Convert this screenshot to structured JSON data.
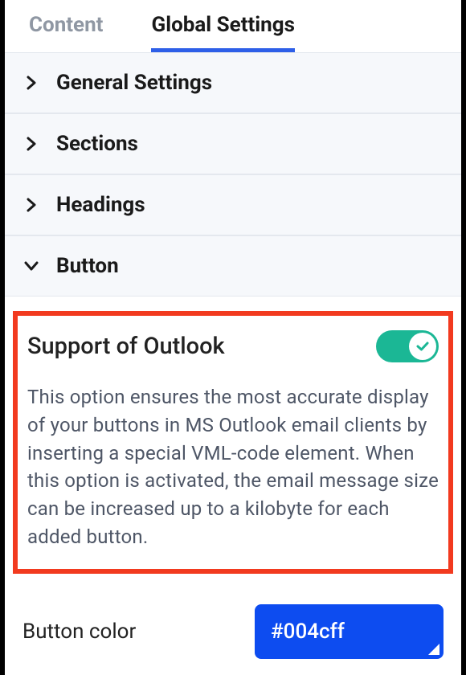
{
  "tabs": {
    "content": "Content",
    "global": "Global Settings"
  },
  "sections": {
    "general": "General Settings",
    "sections": "Sections",
    "headings": "Headings",
    "button": "Button"
  },
  "outlook": {
    "title": "Support of Outlook",
    "desc": "This option ensures the most accurate display of your buttons in MS Outlook email clients by inserting a special VML-code element. When this option is activated, the email message size can be increased up to a kilobyte for each added button."
  },
  "button_color": {
    "label": "Button color",
    "value": "#004cff"
  }
}
